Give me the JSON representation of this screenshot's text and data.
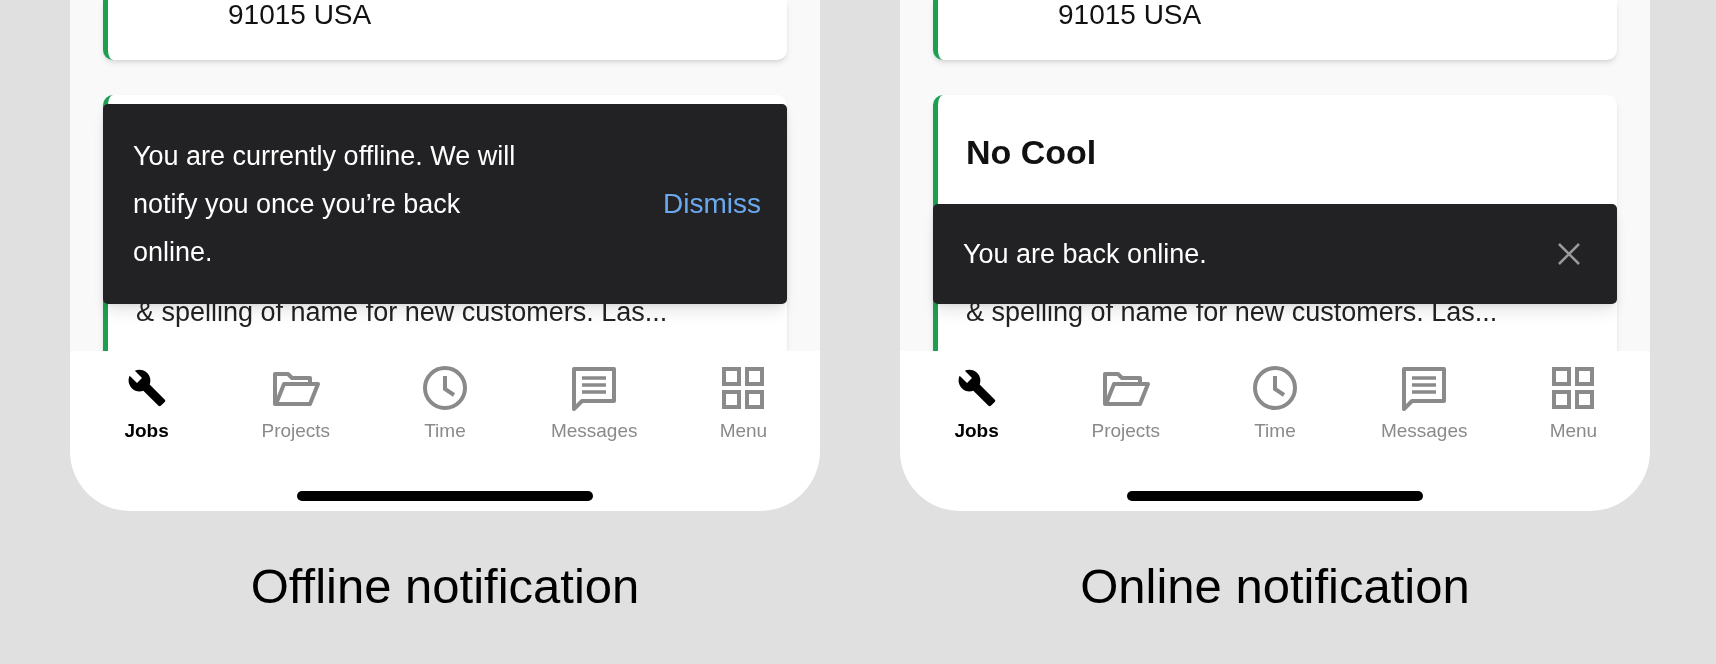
{
  "panels": [
    {
      "address_line": "91015 USA",
      "card_text": "& spelling of name for new customers. Las...",
      "toast": {
        "message": "You are currently offline. We will notify you once you’re back online.",
        "action": {
          "kind": "text",
          "label": "Dismiss"
        }
      },
      "tabs": [
        {
          "label": "Jobs",
          "selected": true,
          "kind": "wrench"
        },
        {
          "label": "Projects",
          "selected": false,
          "kind": "folder"
        },
        {
          "label": "Time",
          "selected": false,
          "kind": "clock"
        },
        {
          "label": "Messages",
          "selected": false,
          "kind": "message"
        },
        {
          "label": "Menu",
          "selected": false,
          "kind": "grid"
        }
      ],
      "caption": "Offline notification"
    },
    {
      "address_line": "91015 USA",
      "card_title": "No Cool",
      "card_text": "& spelling of name for new customers. Las...",
      "toast": {
        "message": "You are back online.",
        "action": {
          "kind": "close"
        }
      },
      "tabs": [
        {
          "label": "Jobs",
          "selected": true,
          "kind": "wrench"
        },
        {
          "label": "Projects",
          "selected": false,
          "kind": "folder"
        },
        {
          "label": "Time",
          "selected": false,
          "kind": "clock"
        },
        {
          "label": "Messages",
          "selected": false,
          "kind": "message"
        },
        {
          "label": "Menu",
          "selected": false,
          "kind": "grid"
        }
      ],
      "caption": "Online notification"
    }
  ]
}
